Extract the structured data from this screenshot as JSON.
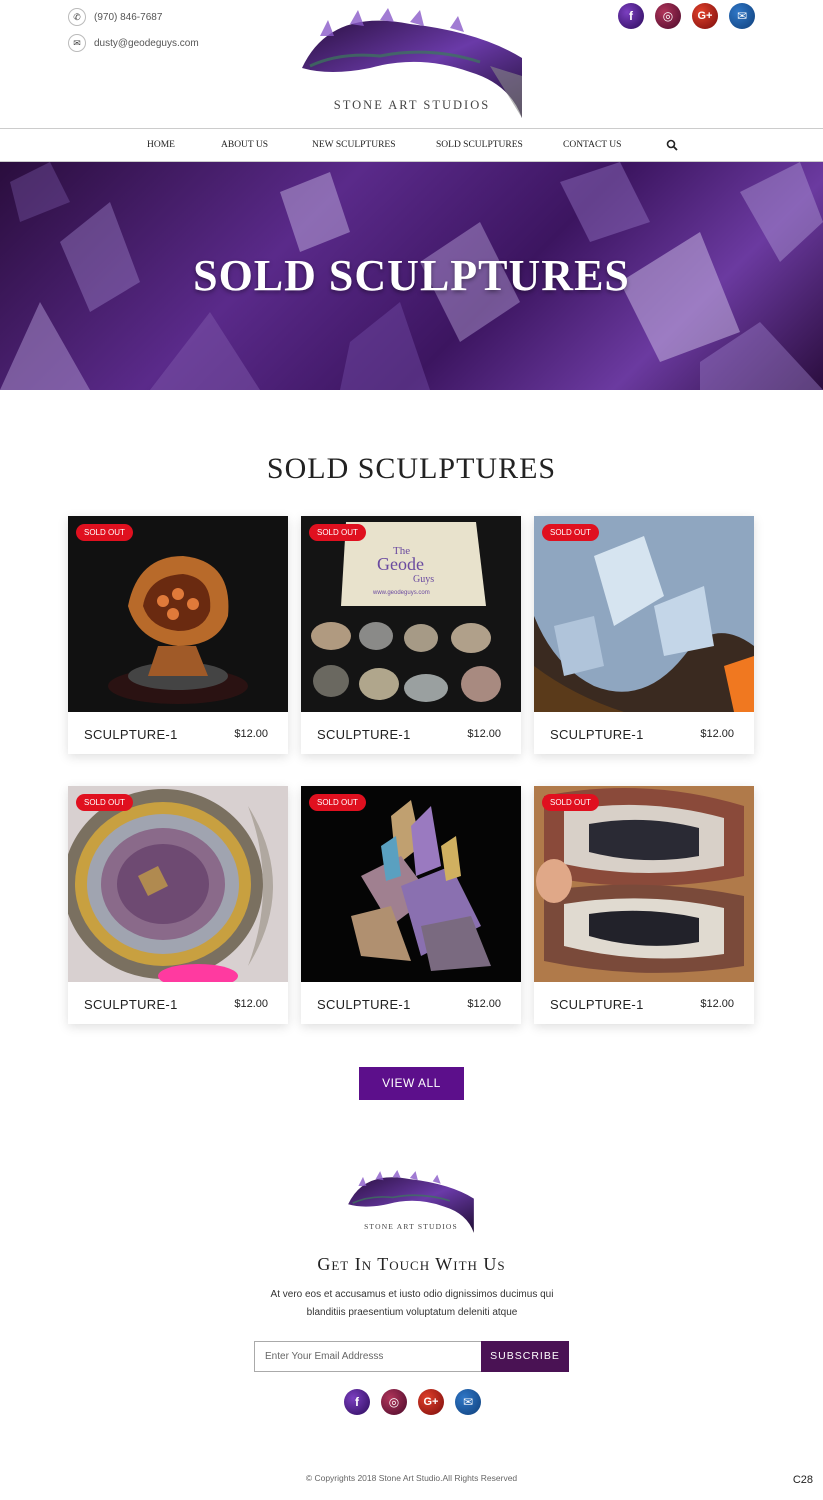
{
  "header": {
    "phone": "(970) 846-7687",
    "email": "dusty@geodeguys.com",
    "logo_text": "STONE ART STUDIOS",
    "socials": [
      {
        "name": "facebook",
        "glyph": "f",
        "color": "#3b1a74"
      },
      {
        "name": "instagram",
        "glyph": "◎",
        "color": "#7a1a3f"
      },
      {
        "name": "google-plus",
        "glyph": "G+",
        "color": "#b31f1f"
      },
      {
        "name": "email",
        "glyph": "✉",
        "color": "#1a5aa0"
      }
    ]
  },
  "nav": {
    "items": [
      "HOME",
      "ABOUT US",
      "NEW SCULPTURES",
      "SOLD SCULPTURES",
      "CONTACT US"
    ]
  },
  "hero": {
    "title": "SOLD SCULPTURES"
  },
  "section": {
    "title": "SOLD SCULPTURES",
    "cards": [
      {
        "badge": "SOLD OUT",
        "name": "SCULPTURE-1",
        "price": "$12.00"
      },
      {
        "badge": "SOLD OUT",
        "name": "SCULPTURE-1",
        "price": "$12.00"
      },
      {
        "badge": "SOLD OUT",
        "name": "SCULPTURE-1",
        "price": "$12.00"
      },
      {
        "badge": "SOLD OUT",
        "name": "SCULPTURE-1",
        "price": "$12.00"
      },
      {
        "badge": "SOLD OUT",
        "name": "SCULPTURE-1",
        "price": "$12.00"
      },
      {
        "badge": "SOLD OUT",
        "name": "SCULPTURE-1",
        "price": "$12.00"
      }
    ],
    "view_all": "VIEW ALL"
  },
  "bag_print": {
    "line1": "The",
    "line2": "Geode",
    "line3": "Guys",
    "url": "www.geodeguys.com"
  },
  "footer": {
    "logo_text": "STONE ART STUDIOS",
    "title": "Get In Touch With Us",
    "text": "At vero eos et accusamus et iusto odio dignissimos ducimus qui blanditiis praesentium voluptatum deleniti atque",
    "email_placeholder": "Enter Your Email Addresss",
    "subscribe": "SUBSCRIBE",
    "copyright": "© Copyrights 2018 Stone Art Studio.All Rights Reserved"
  },
  "page_code": "C28",
  "colors": {
    "accent": "#5c0f8b",
    "subscribe": "#4a1254",
    "badge": "#e0101f"
  }
}
